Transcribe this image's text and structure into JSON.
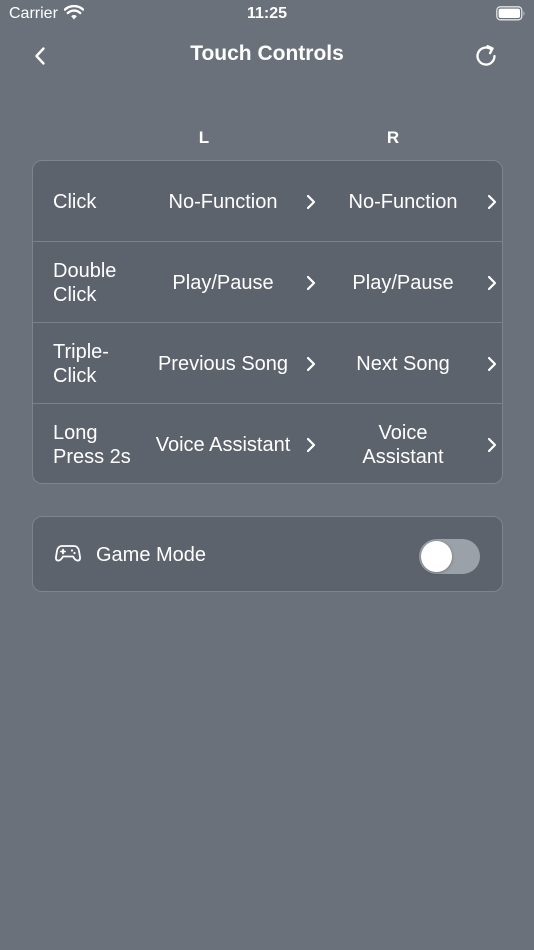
{
  "status": {
    "carrier": "Carrier",
    "time": "11:25"
  },
  "nav": {
    "title": "Touch Controls"
  },
  "columns": {
    "left": "L",
    "right": "R"
  },
  "controls": [
    {
      "label_lines": [
        "Click"
      ],
      "left": [
        "No-Function"
      ],
      "right": [
        "No-Function"
      ]
    },
    {
      "label_lines": [
        "Double",
        "Click"
      ],
      "left": [
        "Play/Pause"
      ],
      "right": [
        "Play/Pause"
      ]
    },
    {
      "label_lines": [
        "Triple-",
        "Click"
      ],
      "left": [
        "Previous Song"
      ],
      "right": [
        "Next Song"
      ]
    },
    {
      "label_lines": [
        "Long",
        "Press 2s"
      ],
      "left": [
        "Voice Assistant"
      ],
      "right": [
        "Voice",
        "Assistant"
      ]
    }
  ],
  "game_mode": {
    "label": "Game Mode",
    "enabled": false
  },
  "icons": {
    "back": "chevron-left-icon",
    "refresh": "refresh-icon",
    "game": "gamepad-icon",
    "row_chevron": "chevron-right-icon"
  },
  "colors": {
    "background": "#6a717a",
    "card": "#5d636c",
    "toggle_off": "#9ba1a8"
  }
}
